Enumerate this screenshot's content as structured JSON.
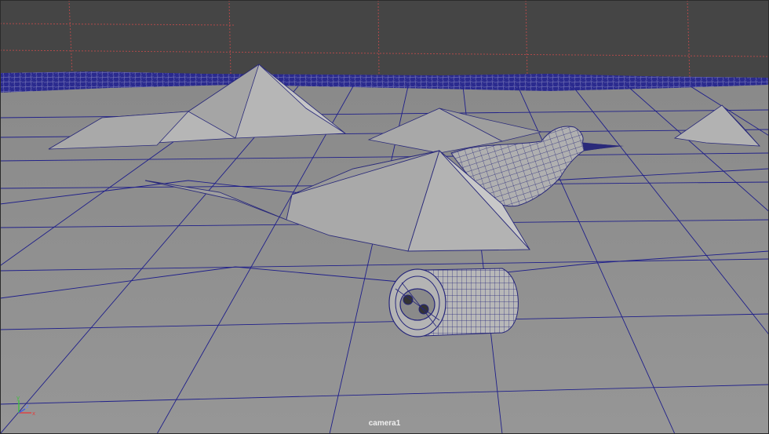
{
  "viewport": {
    "camera_name": "camera1",
    "axis_labels": {
      "x": "x",
      "y": "y",
      "z": "z"
    },
    "colors": {
      "background": "#454545",
      "ground": "#8f8f8f",
      "wire": "#1f1f8a",
      "horizon_grid": "#b04a4a",
      "mesh_light": "#b5b5b5",
      "mesh_mid": "#9a9a9a",
      "mesh_dark": "#7d7d7d"
    }
  }
}
